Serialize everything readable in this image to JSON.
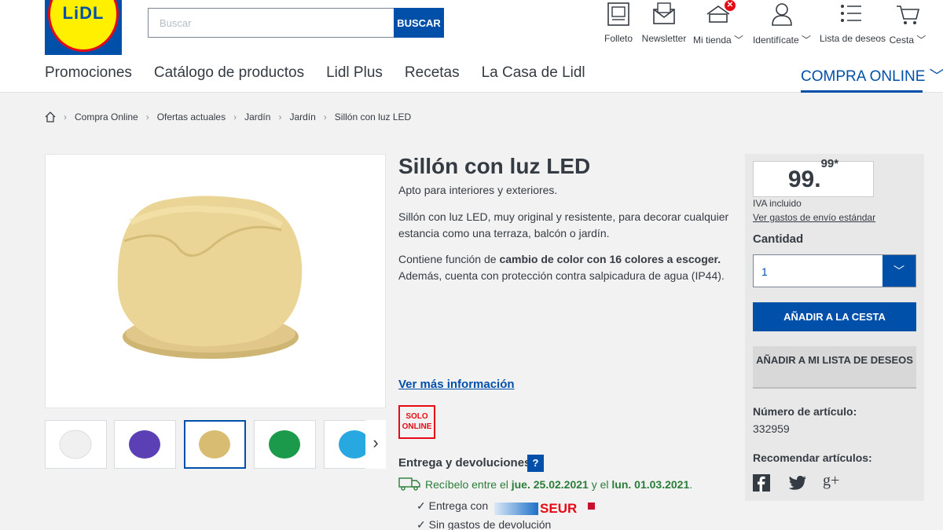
{
  "header": {
    "logo_text": "LiDL",
    "search_placeholder": "Buscar",
    "search_button": "BUSCAR",
    "utility": [
      {
        "label": "Folleto",
        "icon": "flyer-icon"
      },
      {
        "label": "Newsletter",
        "icon": "newsletter-icon"
      },
      {
        "label": "Mi tienda",
        "icon": "store-icon",
        "badge": "✕"
      },
      {
        "label": "Identifícate",
        "icon": "user-icon"
      },
      {
        "label": "Lista de deseos",
        "icon": "wishlist-icon"
      },
      {
        "label": "Cesta",
        "icon": "cart-icon"
      }
    ],
    "chevron": "﹀"
  },
  "nav": {
    "items": [
      "Promociones",
      "Catálogo de productos",
      "Lidl Plus",
      "Recetas",
      "La Casa de Lidl"
    ],
    "online": "COMPRA ONLINE"
  },
  "breadcrumb": [
    "Compra Online",
    "Ofertas actuales",
    "Jardín",
    "Jardín",
    "Sillón con luz LED"
  ],
  "product": {
    "title": "Sillón con luz LED",
    "subtitle": "Apto para interiores y exteriores.",
    "desc1": "Sillón con luz LED, muy original y resistente, para decorar cualquier estancia como una terraza, balcón o jardín.",
    "desc2_pre": "Contiene función de ",
    "desc2_bold": "cambio de color con 16 colores a escoger.",
    "desc2_post": "Además, cuenta con protección contra salpicadura de agua (IP44).",
    "more_info": "Ver más información",
    "badge": "SOLO ONLINE",
    "thumbnail_colors": [
      "#f4f4f4",
      "#5a3fb5",
      "#d8bc72",
      "#1a9a4a",
      "#28a8e0"
    ]
  },
  "delivery": {
    "heading": "Entrega y devoluciones:",
    "help": "?",
    "receive_pre": "Recíbelo entre el ",
    "date1": "jue. 25.02.2021",
    "receive_mid": " y el ",
    "date2": "lun. 01.03.2021",
    "receive_post": ".",
    "check1": "Entrega con",
    "carrier": "SEUR",
    "check2": "Sin gastos de devolución"
  },
  "buybox": {
    "price_int": "99.",
    "price_dec": "99*",
    "vat": "IVA incluido",
    "shipping_link": "Ver gastos de envío estándar",
    "qty_label": "Cantidad",
    "qty_value": "1",
    "add_cart": "AÑADIR A LA CESTA",
    "add_wishlist": "AÑADIR A MI LISTA DE DESEOS",
    "article_label": "Número de artículo:",
    "article_number": "332959",
    "recommend_label": "Recomendar artículos:",
    "social": [
      "facebook-icon",
      "twitter-icon",
      "google-plus-icon"
    ],
    "gplus_text": "g+"
  }
}
